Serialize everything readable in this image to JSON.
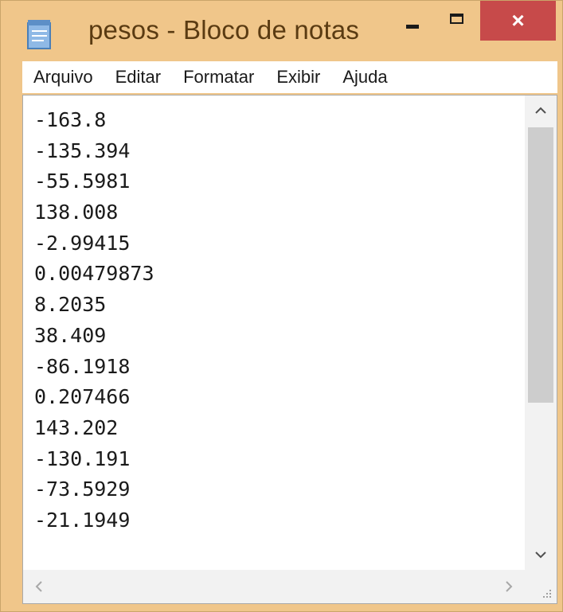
{
  "window": {
    "title": "pesos - Bloco de notas",
    "app_icon": "notepad-icon",
    "controls": {
      "minimize_icon": "minimize-icon",
      "maximize_icon": "maximize-icon",
      "close_label": "×"
    },
    "colors": {
      "frame": "#f0c68a",
      "close": "#c74a4a"
    }
  },
  "menu": {
    "items": [
      "Arquivo",
      "Editar",
      "Formatar",
      "Exibir",
      "Ajuda"
    ]
  },
  "editor": {
    "lines": [
      "-163.8",
      "-135.394",
      "-55.5981",
      "138.008",
      "-2.99415",
      "0.00479873",
      "8.2035",
      "38.409",
      "-86.1918",
      "0.207466",
      "143.202",
      "-130.191",
      "-73.5929",
      "-21.1949"
    ]
  },
  "scrollbars": {
    "vertical_up": "^",
    "vertical_down": "v",
    "horizontal_left": "<",
    "horizontal_right": ">"
  }
}
